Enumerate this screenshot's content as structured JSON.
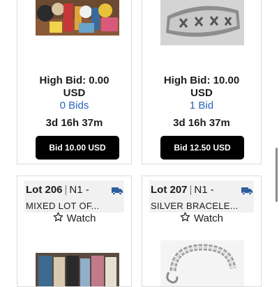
{
  "cards_top": [
    {
      "high_bid_line1": "High Bid: 0.00",
      "high_bid_line2": "USD",
      "bids": "0 Bids",
      "time_left": "3d 16h 37m",
      "bid_button": "Bid 10.00 USD"
    },
    {
      "high_bid_line1": "High Bid: 10.00",
      "high_bid_line2": "USD",
      "bids": "1 Bid",
      "time_left": "3d 16h 37m",
      "bid_button": "Bid 12.50 USD"
    }
  ],
  "cards_bottom": [
    {
      "lot": "Lot 206",
      "separator": "|",
      "code": "N1 -",
      "title": "MIXED LOT OF...",
      "watch": "Watch",
      "icons": {
        "shipping": "truck-icon",
        "watch": "star-outline-icon"
      }
    },
    {
      "lot": "Lot 207",
      "separator": "|",
      "code": "N1 -",
      "title": "SILVER BRACELE...",
      "watch": "Watch",
      "icons": {
        "shipping": "truck-icon",
        "watch": "star-outline-icon"
      }
    }
  ],
  "colors": {
    "link_blue": "#2a63b8",
    "button_bg": "#000000",
    "truck_blue": "#2e5f9e",
    "card_border": "#dcdcdc",
    "header_bg": "#f1f1f1"
  }
}
